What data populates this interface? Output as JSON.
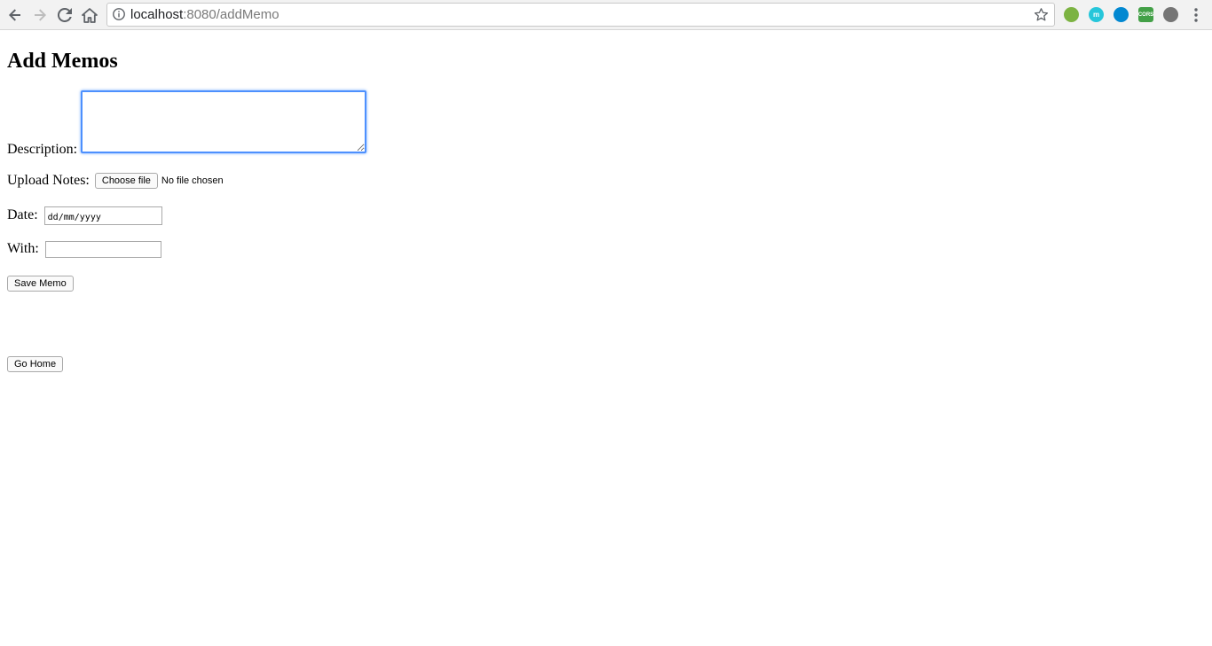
{
  "browser": {
    "url_host": "localhost",
    "url_rest": ":8080/addMemo",
    "extensions": [
      {
        "name": "ext-1",
        "label": "",
        "color": "#7cb342"
      },
      {
        "name": "ext-2",
        "label": "m",
        "color": "#26c6da"
      },
      {
        "name": "ext-3",
        "label": "",
        "color": "#0288d1"
      },
      {
        "name": "ext-4",
        "label": "CORS",
        "color": "#43a047"
      },
      {
        "name": "ext-5",
        "label": "",
        "color": "#757575"
      }
    ]
  },
  "page": {
    "title": "Add Memos",
    "description_label": "Description:",
    "description_value": "",
    "upload_label": "Upload Notes:",
    "file_button_label": "Choose file",
    "file_status": "No file chosen",
    "date_label": "Date:",
    "date_placeholder": "dd/mm/yyyy",
    "with_label": "With:",
    "with_value": "",
    "save_button_label": "Save Memo",
    "home_button_label": "Go Home"
  }
}
